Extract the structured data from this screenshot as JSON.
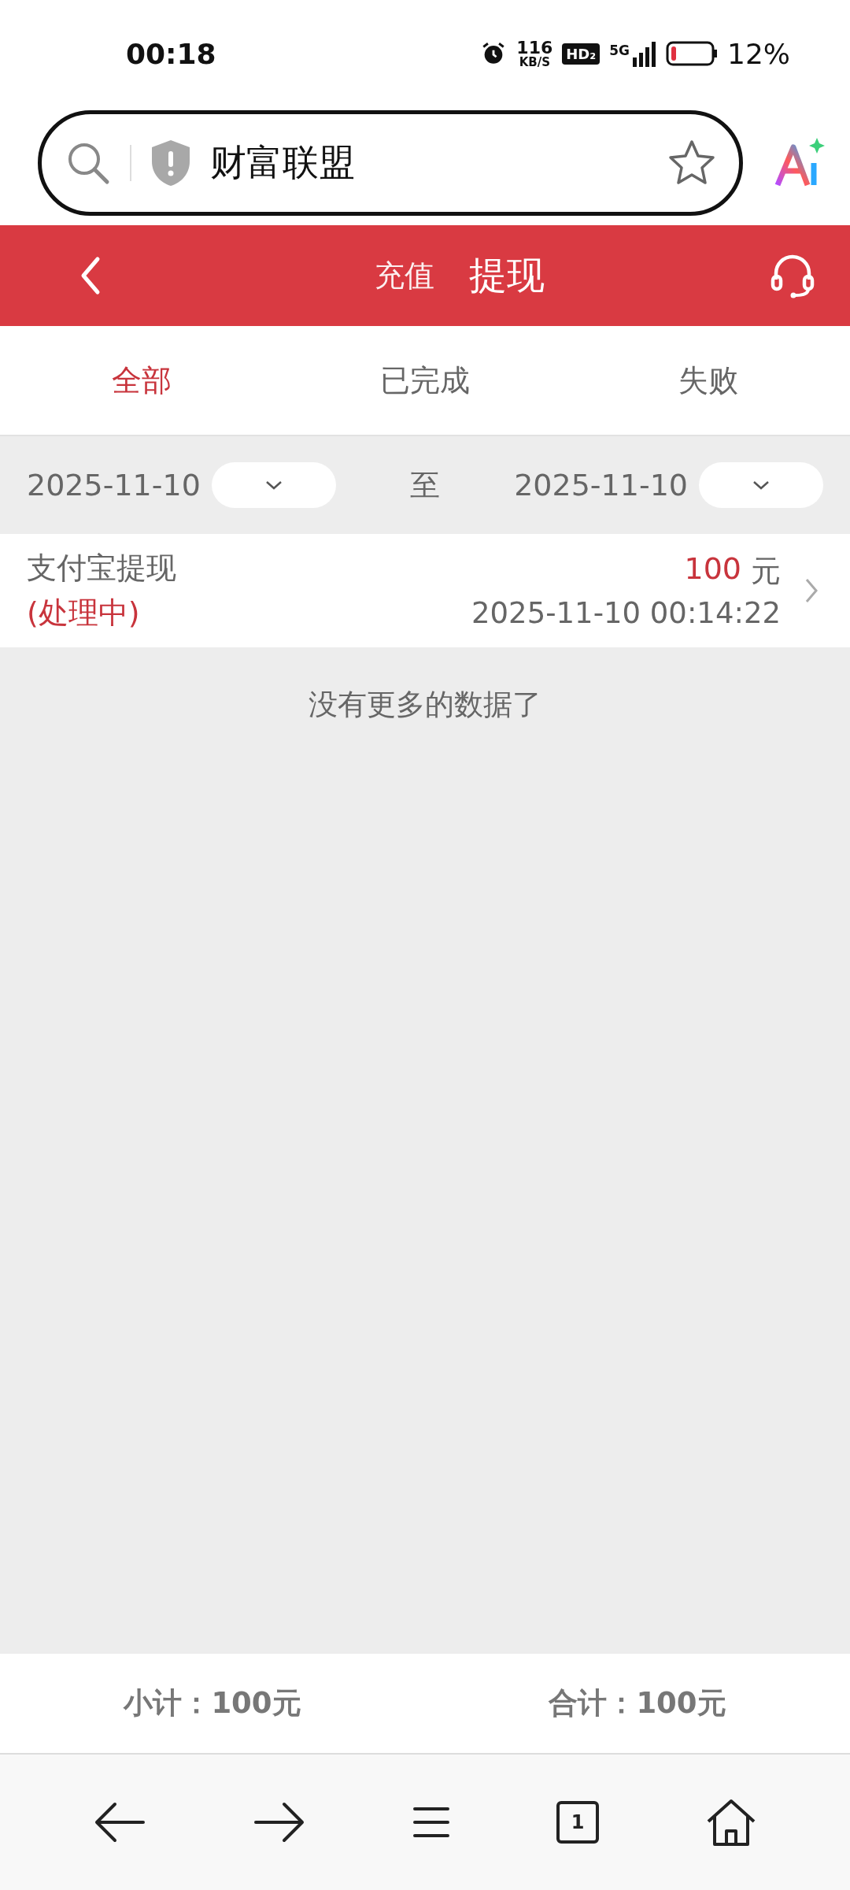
{
  "status_bar": {
    "time": "00:18",
    "speed": "116",
    "speed_unit": "KB/S",
    "hd": "HD₂",
    "network": "5G",
    "battery": "12%"
  },
  "address_bar": {
    "site_title": "财富联盟"
  },
  "header": {
    "tabs": [
      {
        "label": "充值",
        "selected": false
      },
      {
        "label": "提现",
        "selected": true
      }
    ]
  },
  "filter_tabs": [
    {
      "label": "全部",
      "selected": true
    },
    {
      "label": "已完成",
      "selected": false
    },
    {
      "label": "失败",
      "selected": false
    }
  ],
  "date_range": {
    "start": "2025-11-10",
    "separator": "至",
    "end": "2025-11-10"
  },
  "records": [
    {
      "title": "支付宝提现",
      "status": "(处理中)",
      "amount": "100",
      "unit": "元",
      "time": "2025-11-10 00:14:22"
    }
  ],
  "list_end": "没有更多的数据了",
  "totals": {
    "subtotal": "小计：100元",
    "total": "合计：100元"
  },
  "bottom_nav": {
    "tab_count": "1"
  }
}
